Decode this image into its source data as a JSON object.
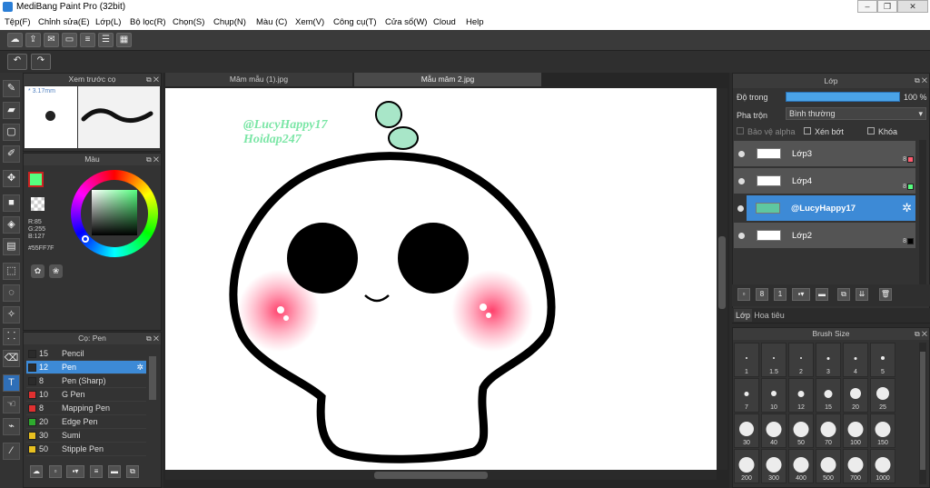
{
  "window": {
    "title": "MediBang Paint Pro (32bit)"
  },
  "menu": [
    "Tệp(F)",
    "Chỉnh sửa(E)",
    "Lớp(L)",
    "Bộ lọc(R)",
    "Chọn(S)",
    "Chụp(N)",
    "Màu (C)",
    "Xem(V)",
    "Công cụ(T)",
    "Cửa sổ(W)",
    "Cloud",
    "Help"
  ],
  "brushPreview": {
    "title": "Xem trước cọ",
    "size": "3.17mm"
  },
  "color": {
    "title": "Màu",
    "r": "R:85",
    "g": "G:255",
    "b": "B:127",
    "hex": "#55FF7F",
    "current": "#55ff7f"
  },
  "brushPanel": {
    "title": "Cọ: Pen",
    "items": [
      {
        "num": "15",
        "label": "Pencil",
        "color": "#2b2b2b"
      },
      {
        "num": "12",
        "label": "Pen",
        "color": "#2b2b2b"
      },
      {
        "num": "8",
        "label": "Pen (Sharp)",
        "color": "#2b2b2b"
      },
      {
        "num": "10",
        "label": "G Pen",
        "color": "#e03030"
      },
      {
        "num": "8",
        "label": "Mapping Pen",
        "color": "#e03030"
      },
      {
        "num": "20",
        "label": "Edge Pen",
        "color": "#2eaa2e"
      },
      {
        "num": "30",
        "label": "Sumi",
        "color": "#e8c020"
      },
      {
        "num": "50",
        "label": "Stipple Pen",
        "color": "#e8c020"
      }
    ]
  },
  "tabs": [
    "Mâm mẫu (1).jpg",
    "Mẫu mâm 2.jpg"
  ],
  "watermark": {
    "line1": "@LucyHappy17",
    "line2": "Hoidap247"
  },
  "layerPanel": {
    "title": "Lớp",
    "opacityLabel": "Độ trong",
    "opacityValue": "100 %",
    "blendLabel": "Pha trộn",
    "blendValue": "Bình thường",
    "protectAlpha": "Bảo vệ alpha",
    "clipping": "Xén bớt",
    "lock": "Khóa",
    "layers": [
      {
        "name": "Lớp3",
        "num": "8",
        "color": "#ff5a6e"
      },
      {
        "name": "Lớp4",
        "num": "8",
        "color": "#55ff7f"
      },
      {
        "name": "@LucyHappy17",
        "num": "",
        "color": ""
      },
      {
        "name": "Lớp2",
        "num": "8",
        "color": "#000000"
      }
    ],
    "tabLayer": "Lớp",
    "tabNav": "Hoa tiêu"
  },
  "brushSize": {
    "title": "Brush Size",
    "sizes": [
      "1",
      "1.5",
      "2",
      "3",
      "4",
      "5",
      "7",
      "10",
      "12",
      "15",
      "20",
      "25",
      "30",
      "40",
      "50",
      "70",
      "100",
      "150",
      "200",
      "300",
      "400",
      "500",
      "700",
      "1000"
    ]
  }
}
